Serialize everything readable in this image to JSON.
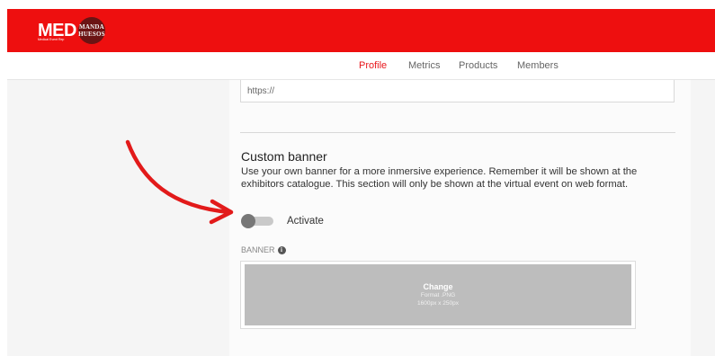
{
  "brand": {
    "logo_text": "MED",
    "badge_line1": "MANDA",
    "badge_line2": "HUESOS",
    "tagline": "Medical Event Rep",
    "bar_color": "#ee0f0f"
  },
  "nav": {
    "tabs": [
      {
        "label": "Profile",
        "active": true
      },
      {
        "label": "Metrics",
        "active": false
      },
      {
        "label": "Products",
        "active": false
      },
      {
        "label": "Members",
        "active": false
      }
    ],
    "active_color": "#e8161b"
  },
  "url_field": {
    "value": "https://"
  },
  "custom_banner": {
    "title": "Custom banner",
    "description": "Use your own banner for a more inmersive experience. Remember it will be shown at the exhibitors catalogue. This section will only be shown at the virtual event on web format.",
    "toggle": {
      "label": "Activate",
      "on": false
    },
    "banner_label": "BANNER",
    "info_icon": "info-icon",
    "upload": {
      "action_label": "Change",
      "format_text": "Format .PNG",
      "size_text": "1600px x 250px"
    }
  },
  "annotation": {
    "arrow_color": "#e21a1a",
    "arrow_icon": "curved-arrow-icon"
  }
}
